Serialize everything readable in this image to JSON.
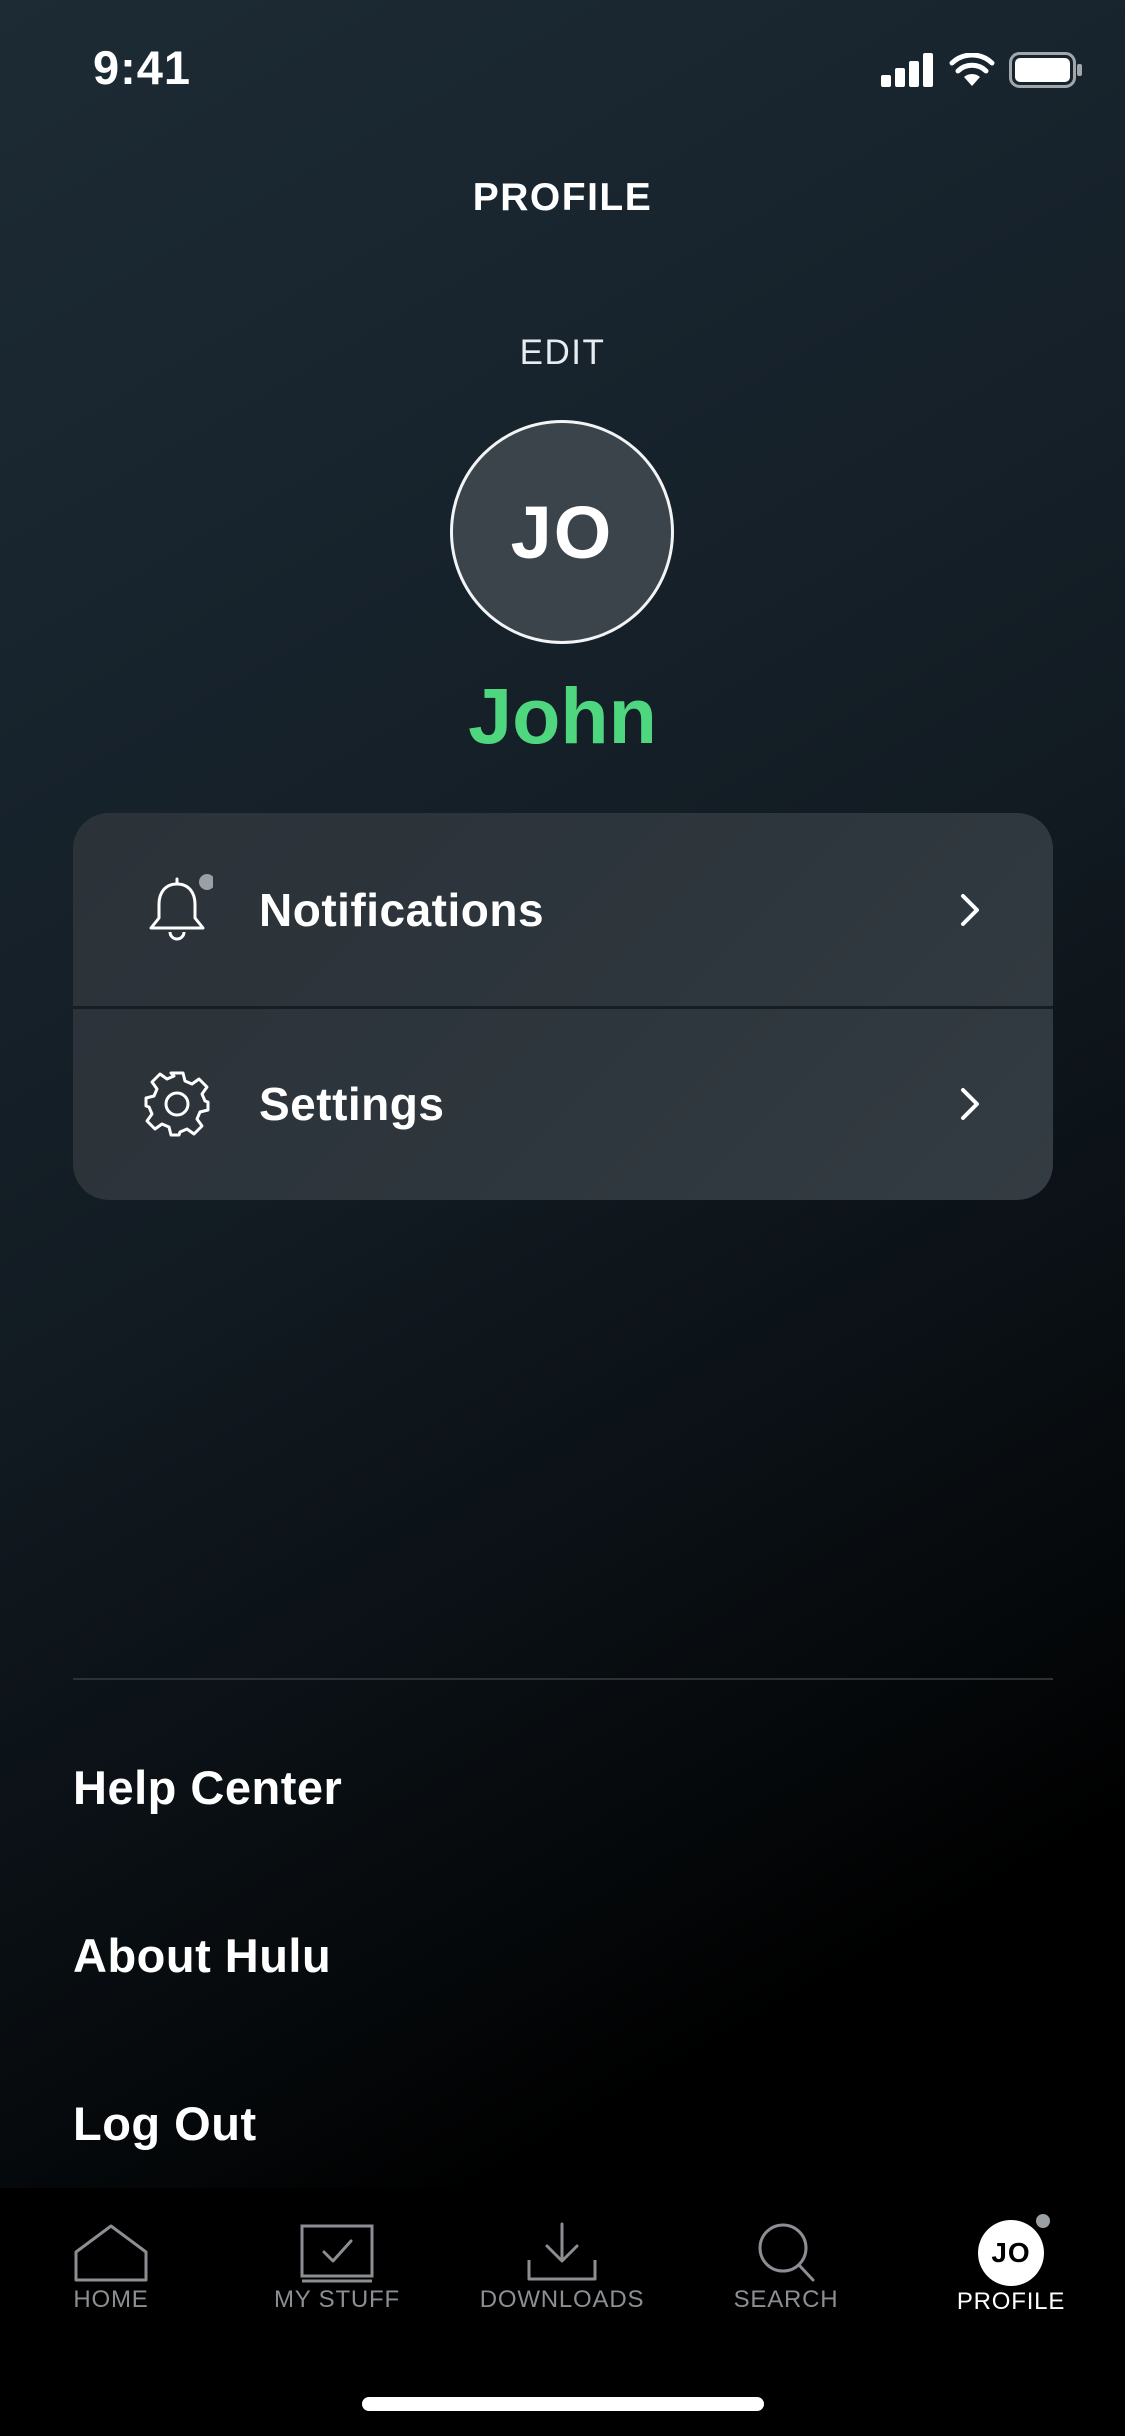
{
  "status_bar": {
    "time": "9:41",
    "icons": [
      "signal-icon",
      "wifi-icon",
      "battery-icon"
    ]
  },
  "header": {
    "title": "PROFILE",
    "edit_label": "EDIT"
  },
  "profile": {
    "initials": "JO",
    "name": "John",
    "name_color": "#4fd77f"
  },
  "menu": {
    "items": [
      {
        "label": "Notifications",
        "icon": "bell-icon",
        "has_unread_dot": true
      },
      {
        "label": "Settings",
        "icon": "gear-icon",
        "has_unread_dot": false
      }
    ]
  },
  "links": {
    "help": "Help Center",
    "about": "About Hulu",
    "logout": "Log Out"
  },
  "tab_bar": {
    "active": "PROFILE",
    "tabs": [
      {
        "label": "HOME",
        "icon": "home-icon"
      },
      {
        "label": "MY STUFF",
        "icon": "my-stuff-icon"
      },
      {
        "label": "DOWNLOADS",
        "icon": "download-icon"
      },
      {
        "label": "SEARCH",
        "icon": "search-icon"
      },
      {
        "label": "PROFILE",
        "icon": "avatar",
        "initials": "JO"
      }
    ]
  }
}
